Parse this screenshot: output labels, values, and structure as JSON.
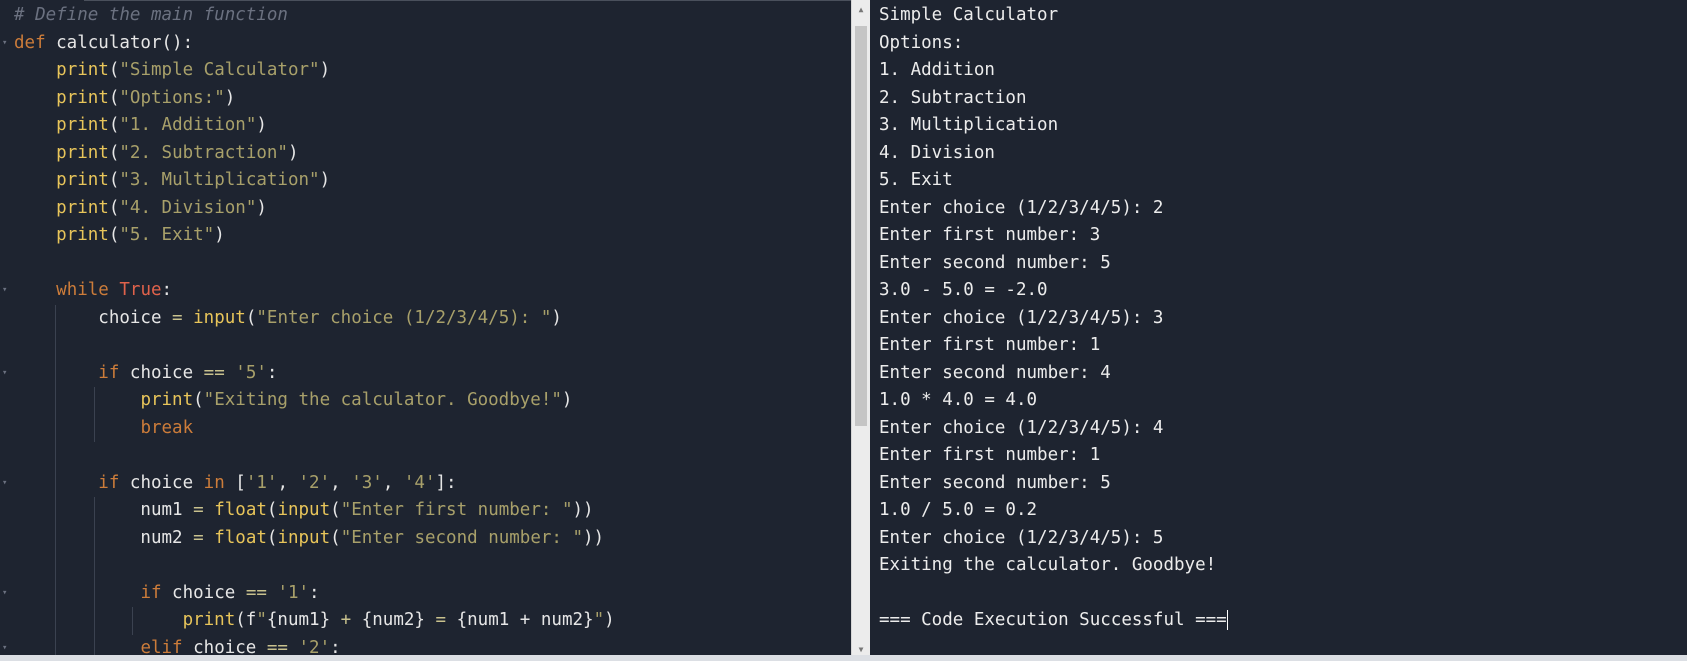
{
  "editor": {
    "language": "python",
    "lines": [
      {
        "fold": false,
        "tokens": [
          {
            "t": "# Define the main function",
            "c": "cm"
          }
        ]
      },
      {
        "fold": true,
        "tokens": [
          {
            "t": "def",
            "c": "k"
          },
          {
            "t": " calculator():",
            "c": "p"
          }
        ]
      },
      {
        "fold": false,
        "tokens": [
          {
            "t": "    ",
            "c": "p"
          },
          {
            "t": "print",
            "c": "f"
          },
          {
            "t": "(",
            "c": "p"
          },
          {
            "t": "\"Simple Calculator\"",
            "c": "s"
          },
          {
            "t": ")",
            "c": "p"
          }
        ]
      },
      {
        "fold": false,
        "tokens": [
          {
            "t": "    ",
            "c": "p"
          },
          {
            "t": "print",
            "c": "f"
          },
          {
            "t": "(",
            "c": "p"
          },
          {
            "t": "\"Options:\"",
            "c": "s"
          },
          {
            "t": ")",
            "c": "p"
          }
        ]
      },
      {
        "fold": false,
        "tokens": [
          {
            "t": "    ",
            "c": "p"
          },
          {
            "t": "print",
            "c": "f"
          },
          {
            "t": "(",
            "c": "p"
          },
          {
            "t": "\"1. Addition\"",
            "c": "s"
          },
          {
            "t": ")",
            "c": "p"
          }
        ]
      },
      {
        "fold": false,
        "tokens": [
          {
            "t": "    ",
            "c": "p"
          },
          {
            "t": "print",
            "c": "f"
          },
          {
            "t": "(",
            "c": "p"
          },
          {
            "t": "\"2. Subtraction\"",
            "c": "s"
          },
          {
            "t": ")",
            "c": "p"
          }
        ]
      },
      {
        "fold": false,
        "tokens": [
          {
            "t": "    ",
            "c": "p"
          },
          {
            "t": "print",
            "c": "f"
          },
          {
            "t": "(",
            "c": "p"
          },
          {
            "t": "\"3. Multiplication\"",
            "c": "s"
          },
          {
            "t": ")",
            "c": "p"
          }
        ]
      },
      {
        "fold": false,
        "tokens": [
          {
            "t": "    ",
            "c": "p"
          },
          {
            "t": "print",
            "c": "f"
          },
          {
            "t": "(",
            "c": "p"
          },
          {
            "t": "\"4. Division\"",
            "c": "s"
          },
          {
            "t": ")",
            "c": "p"
          }
        ]
      },
      {
        "fold": false,
        "tokens": [
          {
            "t": "    ",
            "c": "p"
          },
          {
            "t": "print",
            "c": "f"
          },
          {
            "t": "(",
            "c": "p"
          },
          {
            "t": "\"5. Exit\"",
            "c": "s"
          },
          {
            "t": ")",
            "c": "p"
          }
        ]
      },
      {
        "fold": false,
        "tokens": []
      },
      {
        "fold": true,
        "tokens": [
          {
            "t": "    ",
            "c": "p"
          },
          {
            "t": "while",
            "c": "k"
          },
          {
            "t": " ",
            "c": "p"
          },
          {
            "t": "True",
            "c": "tr"
          },
          {
            "t": ":",
            "c": "p"
          }
        ]
      },
      {
        "fold": false,
        "tokens": [
          {
            "t": "        choice ",
            "c": "p"
          },
          {
            "t": "=",
            "c": "op"
          },
          {
            "t": " ",
            "c": "p"
          },
          {
            "t": "input",
            "c": "f"
          },
          {
            "t": "(",
            "c": "p"
          },
          {
            "t": "\"Enter choice (1/2/3/4/5): \"",
            "c": "s"
          },
          {
            "t": ")",
            "c": "p"
          }
        ]
      },
      {
        "fold": false,
        "tokens": []
      },
      {
        "fold": true,
        "tokens": [
          {
            "t": "        ",
            "c": "p"
          },
          {
            "t": "if",
            "c": "k"
          },
          {
            "t": " choice ",
            "c": "p"
          },
          {
            "t": "==",
            "c": "op"
          },
          {
            "t": " ",
            "c": "p"
          },
          {
            "t": "'5'",
            "c": "s"
          },
          {
            "t": ":",
            "c": "p"
          }
        ]
      },
      {
        "fold": false,
        "tokens": [
          {
            "t": "            ",
            "c": "p"
          },
          {
            "t": "print",
            "c": "f"
          },
          {
            "t": "(",
            "c": "p"
          },
          {
            "t": "\"Exiting the calculator. Goodbye!\"",
            "c": "s"
          },
          {
            "t": ")",
            "c": "p"
          }
        ]
      },
      {
        "fold": false,
        "tokens": [
          {
            "t": "            ",
            "c": "p"
          },
          {
            "t": "break",
            "c": "k"
          }
        ]
      },
      {
        "fold": false,
        "tokens": []
      },
      {
        "fold": true,
        "tokens": [
          {
            "t": "        ",
            "c": "p"
          },
          {
            "t": "if",
            "c": "k"
          },
          {
            "t": " choice ",
            "c": "p"
          },
          {
            "t": "in",
            "c": "k"
          },
          {
            "t": " [",
            "c": "p"
          },
          {
            "t": "'1'",
            "c": "s"
          },
          {
            "t": ", ",
            "c": "p"
          },
          {
            "t": "'2'",
            "c": "s"
          },
          {
            "t": ", ",
            "c": "p"
          },
          {
            "t": "'3'",
            "c": "s"
          },
          {
            "t": ", ",
            "c": "p"
          },
          {
            "t": "'4'",
            "c": "s"
          },
          {
            "t": "]:",
            "c": "p"
          }
        ]
      },
      {
        "fold": false,
        "tokens": [
          {
            "t": "            num1 ",
            "c": "p"
          },
          {
            "t": "=",
            "c": "op"
          },
          {
            "t": " ",
            "c": "p"
          },
          {
            "t": "float",
            "c": "f"
          },
          {
            "t": "(",
            "c": "p"
          },
          {
            "t": "input",
            "c": "f"
          },
          {
            "t": "(",
            "c": "p"
          },
          {
            "t": "\"Enter first number: \"",
            "c": "s"
          },
          {
            "t": "))",
            "c": "p"
          }
        ]
      },
      {
        "fold": false,
        "tokens": [
          {
            "t": "            num2 ",
            "c": "p"
          },
          {
            "t": "=",
            "c": "op"
          },
          {
            "t": " ",
            "c": "p"
          },
          {
            "t": "float",
            "c": "f"
          },
          {
            "t": "(",
            "c": "p"
          },
          {
            "t": "input",
            "c": "f"
          },
          {
            "t": "(",
            "c": "p"
          },
          {
            "t": "\"Enter second number: \"",
            "c": "s"
          },
          {
            "t": "))",
            "c": "p"
          }
        ]
      },
      {
        "fold": false,
        "tokens": []
      },
      {
        "fold": true,
        "tokens": [
          {
            "t": "            ",
            "c": "p"
          },
          {
            "t": "if",
            "c": "k"
          },
          {
            "t": " choice ",
            "c": "p"
          },
          {
            "t": "==",
            "c": "op"
          },
          {
            "t": " ",
            "c": "p"
          },
          {
            "t": "'1'",
            "c": "s"
          },
          {
            "t": ":",
            "c": "p"
          }
        ]
      },
      {
        "fold": false,
        "tokens": [
          {
            "t": "                ",
            "c": "p"
          },
          {
            "t": "print",
            "c": "f"
          },
          {
            "t": "(f",
            "c": "p"
          },
          {
            "t": "\"",
            "c": "s"
          },
          {
            "t": "{num1} ",
            "c": "p"
          },
          {
            "t": "+",
            "c": "op"
          },
          {
            "t": " {num2} ",
            "c": "p"
          },
          {
            "t": "=",
            "c": "op"
          },
          {
            "t": " {num1 + num2}",
            "c": "p"
          },
          {
            "t": "\"",
            "c": "s"
          },
          {
            "t": ")",
            "c": "p"
          }
        ]
      },
      {
        "fold": true,
        "tokens": [
          {
            "t": "            ",
            "c": "p"
          },
          {
            "t": "elif",
            "c": "k"
          },
          {
            "t": " choice ",
            "c": "p"
          },
          {
            "t": "==",
            "c": "op"
          },
          {
            "t": " ",
            "c": "p"
          },
          {
            "t": "'2'",
            "c": "s"
          },
          {
            "t": ":",
            "c": "p"
          }
        ]
      }
    ]
  },
  "output": {
    "lines": [
      "Simple Calculator",
      "Options:",
      "1. Addition",
      "2. Subtraction",
      "3. Multiplication",
      "4. Division",
      "5. Exit",
      "Enter choice (1/2/3/4/5): 2",
      "Enter first number: 3",
      "Enter second number: 5",
      "3.0 - 5.0 = -2.0",
      "Enter choice (1/2/3/4/5): 3",
      "Enter first number: 1",
      "Enter second number: 4",
      "1.0 * 4.0 = 4.0",
      "Enter choice (1/2/3/4/5): 4",
      "Enter first number: 1",
      "Enter second number: 5",
      "1.0 / 5.0 = 0.2",
      "Enter choice (1/2/3/4/5): 5",
      "Exiting the calculator. Goodbye!",
      "",
      "=== Code Execution Successful ==="
    ]
  },
  "scrollbar": {
    "up_icon": "chevron-up-icon",
    "down_icon": "chevron-down-icon"
  },
  "colors": {
    "background": "#1e2430",
    "keyword": "#cc7c3a",
    "string": "#a8a06a",
    "function": "#e8c55a",
    "comment": "#6b7180",
    "boolean": "#e0624b",
    "text": "#e6e6e6"
  }
}
